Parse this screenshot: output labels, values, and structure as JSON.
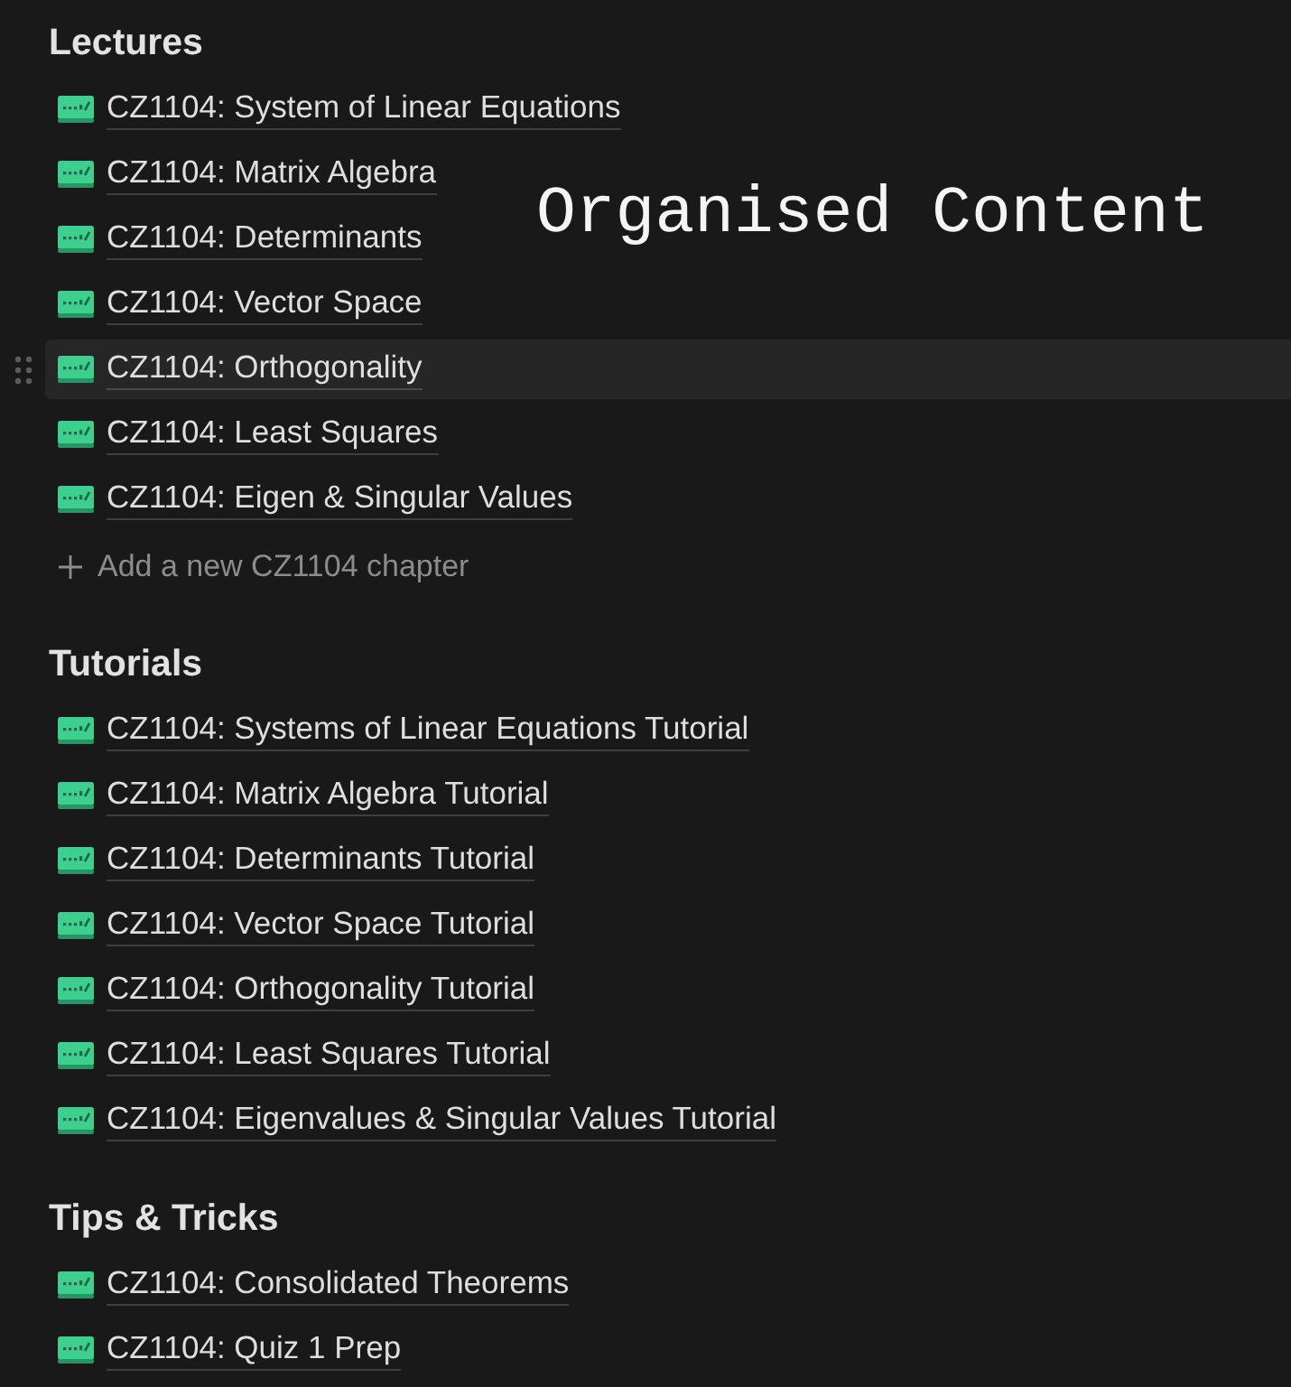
{
  "sections": [
    {
      "heading": "Lectures",
      "items": [
        {
          "title": "CZ1104: System of Linear Equations",
          "highlighted": false
        },
        {
          "title": "CZ1104: Matrix Algebra",
          "highlighted": false
        },
        {
          "title": "CZ1104: Determinants",
          "highlighted": false
        },
        {
          "title": "CZ1104: Vector Space",
          "highlighted": false
        },
        {
          "title": "CZ1104: Orthogonality",
          "highlighted": true
        },
        {
          "title": "CZ1104: Least Squares",
          "highlighted": false
        },
        {
          "title": "CZ1104: Eigen & Singular Values",
          "highlighted": false
        }
      ],
      "add_label": "Add a new CZ1104 chapter"
    },
    {
      "heading": "Tutorials",
      "items": [
        {
          "title": "CZ1104: Systems of Linear Equations Tutorial",
          "highlighted": false
        },
        {
          "title": "CZ1104: Matrix Algebra Tutorial",
          "highlighted": false
        },
        {
          "title": "CZ1104: Determinants Tutorial",
          "highlighted": false
        },
        {
          "title": "CZ1104: Vector Space Tutorial",
          "highlighted": false
        },
        {
          "title": "CZ1104: Orthogonality Tutorial",
          "highlighted": false
        },
        {
          "title": "CZ1104: Least Squares Tutorial",
          "highlighted": false
        },
        {
          "title": "CZ1104: Eigenvalues & Singular Values Tutorial",
          "highlighted": false
        }
      ]
    },
    {
      "heading": "Tips & Tricks",
      "items": [
        {
          "title": "CZ1104: Consolidated Theorems",
          "highlighted": false
        },
        {
          "title": "CZ1104: Quiz 1 Prep",
          "highlighted": false
        }
      ]
    }
  ],
  "overlay": {
    "text": "Organised Content"
  }
}
